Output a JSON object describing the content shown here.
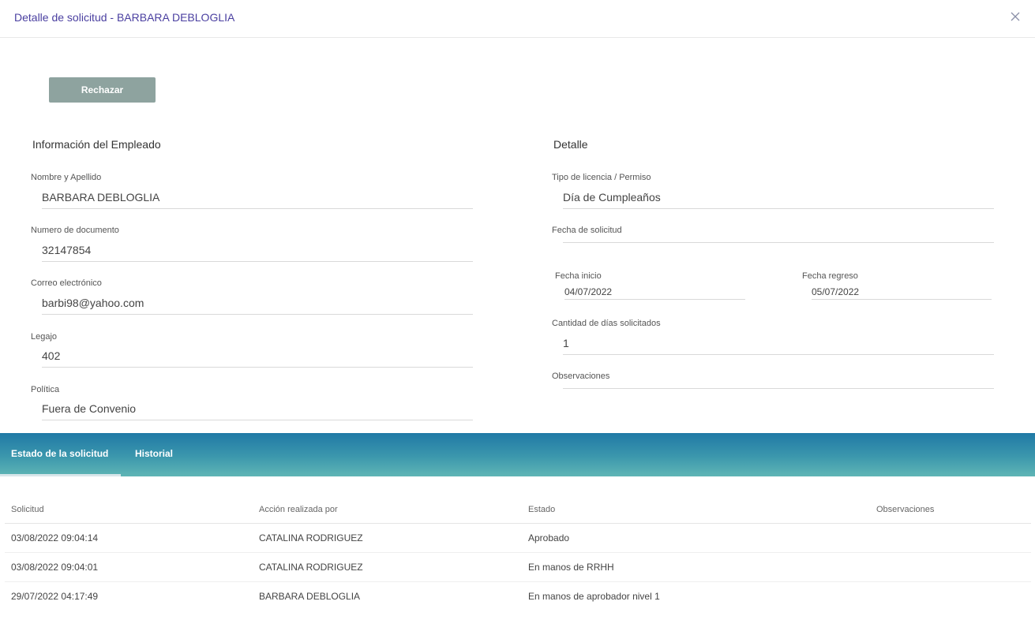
{
  "modal": {
    "title": "Detalle de solicitud - BARBARA DEBLOGLIA",
    "close_glyph": "✕"
  },
  "actions": {
    "reject_label": "Rechazar"
  },
  "employee": {
    "section_title": "Información del Empleado",
    "fields": [
      {
        "label": "Nombre y Apellido",
        "value": "BARBARA DEBLOGLIA"
      },
      {
        "label": "Numero de documento",
        "value": "32147854"
      },
      {
        "label": "Correo electrónico",
        "value": "barbi98@yahoo.com"
      },
      {
        "label": "Legajo",
        "value": "402"
      },
      {
        "label": "Política",
        "value": "Fuera de Convenio"
      }
    ]
  },
  "detail": {
    "section_title": "Detalle",
    "leave_type": {
      "label": "Tipo de licencia / Permiso",
      "value": "Día de Cumpleaños"
    },
    "request_date": {
      "label": "Fecha de solicitud",
      "value": ""
    },
    "start_date": {
      "label": "Fecha inicio",
      "value": "04/07/2022"
    },
    "return_date": {
      "label": "Fecha regreso",
      "value": "05/07/2022"
    },
    "days_requested": {
      "label": "Cantidad de días solicitados",
      "value": "1"
    },
    "observations": {
      "label": "Observaciones",
      "value": ""
    }
  },
  "tabs": [
    {
      "label": "Estado de la solicitud",
      "active": true
    },
    {
      "label": "Historial",
      "active": false
    }
  ],
  "status_table": {
    "columns": [
      "Solicitud",
      "Acción realizada por",
      "Estado",
      "Observaciones"
    ],
    "rows": [
      [
        "03/08/2022 09:04:14",
        "CATALINA RODRIGUEZ",
        "Aprobado",
        ""
      ],
      [
        "03/08/2022 09:04:01",
        "CATALINA RODRIGUEZ",
        "En manos de RRHH",
        ""
      ],
      [
        "29/07/2022 04:17:49",
        "BARBARA DEBLOGLIA",
        "En manos de aprobador nivel 1",
        ""
      ]
    ]
  },
  "colors": {
    "title": "#4a3fa0",
    "reject_button": "#8ea39f",
    "tab_gradient_top": "#2079a6",
    "tab_gradient_bottom": "#5fb5b5"
  }
}
